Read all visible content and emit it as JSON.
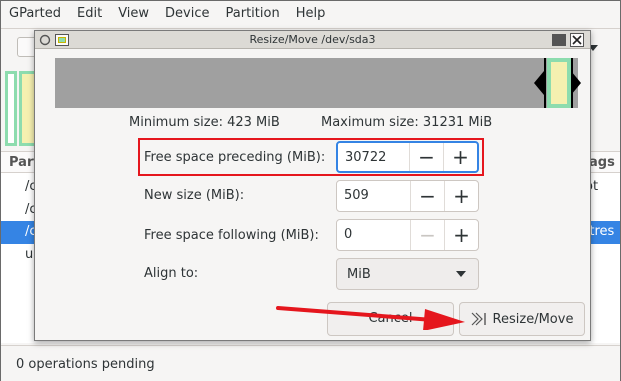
{
  "menubar": {
    "items": [
      "GParted",
      "Edit",
      "View",
      "Device",
      "Partition",
      "Help"
    ]
  },
  "toolbar": {
    "device_suffix": ")"
  },
  "list": {
    "header_partition": "Part",
    "header_flags": "ags",
    "rows": [
      {
        "c1": "/c",
        "c2": "ot"
      },
      {
        "c1": "/c",
        "c2": ""
      },
      {
        "c1": "/c",
        "c2": "ftres"
      },
      {
        "c1": "ur",
        "c2": ""
      }
    ]
  },
  "status": {
    "text": "0 operations pending"
  },
  "dialog": {
    "title": "Resize/Move /dev/sda3",
    "min_size": "Minimum size: 423 MiB",
    "max_size": "Maximum size: 31231 MiB",
    "fields": {
      "preceding": {
        "label": "Free space preceding (MiB):",
        "value": "30722"
      },
      "new_size": {
        "label": "New size (MiB):",
        "value": "509"
      },
      "following": {
        "label": "Free space following (MiB):",
        "value": "0"
      }
    },
    "align": {
      "label": "Align to:",
      "selected": "MiB"
    },
    "buttons": {
      "cancel": "Cancel",
      "resize": "Resize/Move"
    },
    "resize_icon": "resize-move-icon"
  },
  "colors": {
    "highlight": "#e5161d",
    "selection": "#3584e4",
    "partition_border": "#8ddcae",
    "partition_fill": "#f5f0b0",
    "unallocated": "#a0a0a0"
  },
  "icons": {
    "minus": "−",
    "plus": "+"
  }
}
